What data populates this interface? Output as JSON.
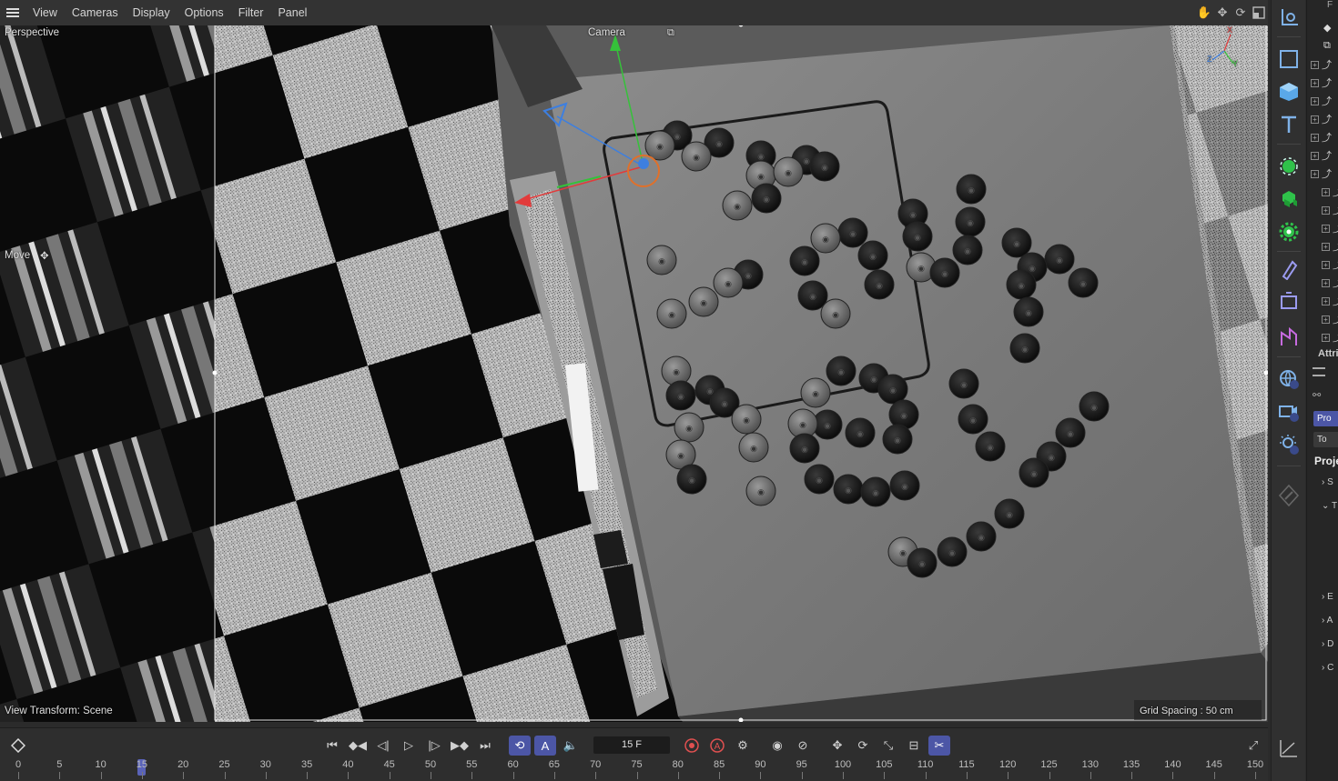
{
  "menubar": {
    "items": [
      "View",
      "Cameras",
      "Display",
      "Options",
      "Filter",
      "Panel"
    ]
  },
  "viewport": {
    "projection_label": "Perspective",
    "camera_label": "Camera",
    "tool_label": "Move",
    "view_transform": "View Transform: Scene",
    "grid_spacing": "Grid Spacing : 50 cm",
    "axis_labels": {
      "x": "X",
      "y": "Y",
      "z": "Z"
    }
  },
  "timeline": {
    "current_frame": "15 F",
    "ruler_labels": [
      "0",
      "5",
      "10",
      "15",
      "20",
      "25",
      "30",
      "35",
      "40",
      "45",
      "50",
      "55",
      "60",
      "65",
      "70",
      "75",
      "80",
      "85",
      "90",
      "95",
      "100",
      "105",
      "110",
      "115",
      "120",
      "125",
      "130",
      "135",
      "140",
      "145",
      "150"
    ],
    "playhead_frame": 15,
    "accent_color": "#4c56a6"
  },
  "object_strip": {
    "header_glyph": "F",
    "attributes_label": "Attri",
    "mode_label": "Pro",
    "to_label": "To",
    "project_label": "Proje",
    "rows": [
      "S",
      "T",
      "E",
      "A",
      "D",
      "C"
    ]
  },
  "colors": {
    "x_axis": "#e23b3b",
    "y_axis": "#35c23a",
    "z_axis": "#3d7fe0",
    "accent": "#4c56a6"
  }
}
